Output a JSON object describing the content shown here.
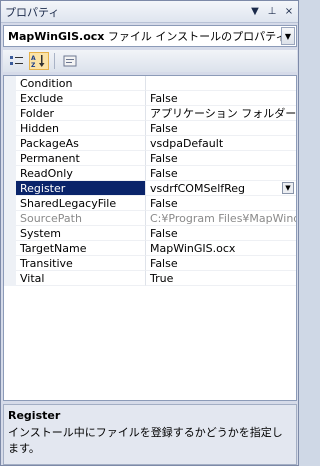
{
  "window": {
    "title": "プロパティ",
    "buttons": {
      "dropdown": "▼",
      "pin": "⊥",
      "close": "×"
    }
  },
  "object_selector": {
    "object_name": "MapWinGIS.ocx",
    "object_type": "ファイル インストールのプロパティ"
  },
  "toolbar": {
    "categorized_icon": "categorized-icon",
    "alphabetical_icon": "alphabetical-icon",
    "property_pages_icon": "property-pages-icon",
    "active": "alphabetical"
  },
  "properties": [
    {
      "name": "Condition",
      "value": ""
    },
    {
      "name": "Exclude",
      "value": "False"
    },
    {
      "name": "Folder",
      "value": "アプリケーション フォルダー"
    },
    {
      "name": "Hidden",
      "value": "False"
    },
    {
      "name": "PackageAs",
      "value": "vsdpaDefault"
    },
    {
      "name": "Permanent",
      "value": "False"
    },
    {
      "name": "ReadOnly",
      "value": "False"
    },
    {
      "name": "Register",
      "value": "vsdrfCOMSelfReg"
    },
    {
      "name": "SharedLegacyFile",
      "value": "False"
    },
    {
      "name": "SourcePath",
      "value": "C:¥Program Files¥MapWindow"
    },
    {
      "name": "System",
      "value": "False"
    },
    {
      "name": "TargetName",
      "value": "MapWinGIS.ocx"
    },
    {
      "name": "Transitive",
      "value": "False"
    },
    {
      "name": "Vital",
      "value": "True"
    }
  ],
  "selected_property": "Register",
  "disabled_property": "SourcePath",
  "description": {
    "title": "Register",
    "text": "インストール中にファイルを登録するかどうかを指定します。"
  },
  "colors": {
    "selection": "#0a246a",
    "toolbar_active": "#fbe3a6"
  }
}
